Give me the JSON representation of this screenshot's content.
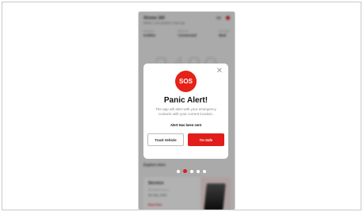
{
  "app": {
    "header_title": "Xtreme 160",
    "header_subtitle": "Mathur | Last updated 2 days ago",
    "stats": [
      {
        "label": "Odometer",
        "value": "9.00km"
      },
      {
        "label": "Bluetooth",
        "value": "Connected"
      },
      {
        "label": "Fuel Level",
        "value": "Med"
      }
    ],
    "background_number": "2480",
    "explore_title": "Explore Hero",
    "service": {
      "title": "Service",
      "line1": "Next service due on",
      "line2": "08 July, 2022",
      "link": "Book Now"
    }
  },
  "modal": {
    "sos_label": "SOS",
    "title": "Panic Alert!",
    "description": "The app will alert with your emergency contacts with your current location.",
    "status": "Alert Has been sent",
    "track_button": "Track Vehicle",
    "safe_button": "I'm Safe",
    "close_symbol": "✕"
  },
  "colors": {
    "accent": "#e21b1b",
    "sos": "#e62117"
  },
  "pager": {
    "count": 5,
    "active_index": 1
  }
}
